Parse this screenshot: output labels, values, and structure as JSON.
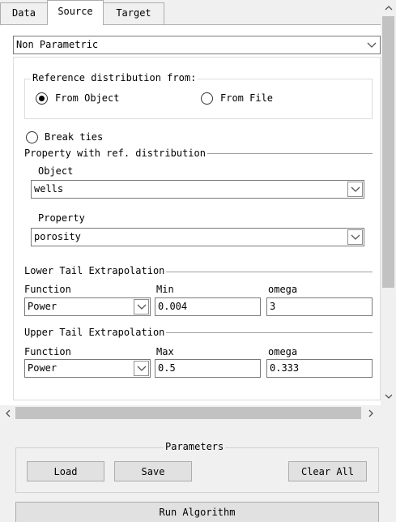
{
  "tabs": [
    "Data",
    "Source",
    "Target"
  ],
  "method": {
    "value": "Non Parametric"
  },
  "reference": {
    "legend": "Reference distribution from:",
    "option_object": "From Object",
    "option_file": "From File",
    "selected": "From Object"
  },
  "break_ties": {
    "label": "Break ties",
    "checked": false
  },
  "property_group": {
    "legend": "Property with ref. distribution",
    "object_label": "Object",
    "object_value": "wells",
    "property_label": "Property",
    "property_value": "porosity"
  },
  "lower_tail": {
    "legend": "Lower Tail Extrapolation",
    "function_label": "Function",
    "function_value": "Power",
    "bound_label": "Min",
    "bound_value": "0.004",
    "omega_label": "omega",
    "omega_value": "3"
  },
  "upper_tail": {
    "legend": "Upper Tail Extrapolation",
    "function_label": "Function",
    "function_value": "Power",
    "bound_label": "Max",
    "bound_value": "0.5",
    "omega_label": "omega",
    "omega_value": "0.333"
  },
  "parameters": {
    "legend": "Parameters",
    "load": "Load",
    "save": "Save",
    "clear_all": "Clear All"
  },
  "run_button": "Run Algorithm",
  "icons": {
    "dropdown": "chevron-down-icon",
    "scroll_up": "chevron-up-icon",
    "scroll_down": "chevron-down-icon",
    "scroll_left": "chevron-left-icon",
    "scroll_right": "chevron-right-icon"
  }
}
